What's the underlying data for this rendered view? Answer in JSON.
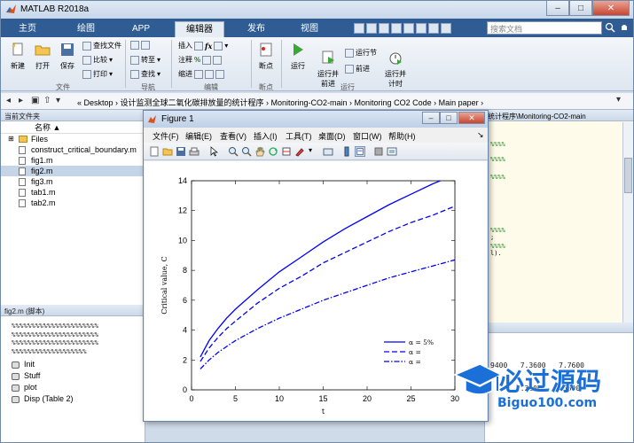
{
  "app": {
    "title": "MATLAB R2018a"
  },
  "tabs": [
    {
      "label": "主页"
    },
    {
      "label": "绘图"
    },
    {
      "label": "APP"
    },
    {
      "label": "编辑器"
    },
    {
      "label": "发布"
    },
    {
      "label": "视图"
    }
  ],
  "search": {
    "placeholder": "搜索文档"
  },
  "ribbon": {
    "file": {
      "new": "新建",
      "open": "打开",
      "save": "保存",
      "find_files": "查找文件",
      "compare": "比较",
      "print": "打印",
      "group": "文件"
    },
    "nav": {
      "goto": "转至",
      "find": "查找",
      "group": "导航"
    },
    "edit": {
      "insert": "插入",
      "comment": "注释",
      "indent": "缩进",
      "group": "编辑"
    },
    "breakpoints": {
      "label": "断点",
      "group": "断点"
    },
    "run": {
      "run": "运行",
      "run_advance": "运行并\n前进",
      "run_section": "运行节",
      "advance": "前进",
      "run_time": "运行并\n计时",
      "group": "运行"
    }
  },
  "pathbar": {
    "crumbs": "«  Desktop  ›  设计监测全球二氧化碳排放量的统计程序  ›  Monitoring-CO2-main  ›  Monitoring CO2 Code  ›  Main paper  ›"
  },
  "current_folder": {
    "header": "当前文件夹",
    "col_name": "名称 ▲",
    "items": [
      {
        "name": "Files"
      },
      {
        "name": "construct_critical_boundary.m"
      },
      {
        "name": "fig1.m"
      },
      {
        "name": "fig2.m"
      },
      {
        "name": "fig3.m"
      },
      {
        "name": "tab1.m"
      },
      {
        "name": "tab2.m"
      }
    ]
  },
  "details": {
    "header": "fig2.m  (脚本)",
    "pct_lines": [
      "%%%%%%%%%%%%%%%%%%%%%%",
      "%%%%%%%%%%%%%%%%%%%%%%",
      "%%%%%%%%%%%%%%%%%%%%%%",
      "%%%%%%%%%%%%%%%%%%%"
    ],
    "cells": [
      {
        "name": "Init"
      },
      {
        "name": "Stuff"
      },
      {
        "name": "plot"
      },
      {
        "name": "Disp (Table 2)"
      }
    ]
  },
  "editor": {
    "header": "统计程序\\Monitoring-CO2-main",
    "lines": [
      "%%%%",
      "%%%%",
      "%%%%",
      "%%%%",
      "%%%%",
      ";",
      "l)."
    ]
  },
  "command": {
    "row1": "9400   7.3600   7.7600",
    "row2": "      4.3200   4.5500"
  },
  "figure": {
    "title": "Figure 1",
    "menus": [
      "文件(F)",
      "编辑(E)",
      "查看(V)",
      "插入(I)",
      "工具(T)",
      "桌面(D)",
      "窗口(W)",
      "帮助(H)"
    ]
  },
  "chart_data": {
    "type": "line",
    "xlabel": "t",
    "ylabel": "Critical value, C",
    "xlim": [
      0,
      30
    ],
    "ylim": [
      0,
      14
    ],
    "xticks": [
      0,
      5,
      10,
      15,
      20,
      25,
      30
    ],
    "yticks": [
      0,
      2,
      4,
      6,
      8,
      10,
      12,
      14
    ],
    "x": [
      1,
      2,
      3,
      4,
      5,
      7.5,
      10,
      12.5,
      15,
      17.5,
      20,
      22.5,
      25,
      27.5,
      30
    ],
    "series": [
      {
        "name": "α = 5%",
        "style": "solid",
        "color": "#0000ff",
        "values": [
          2.2,
          3.3,
          4.1,
          4.8,
          5.4,
          6.7,
          7.9,
          8.9,
          9.9,
          10.8,
          11.6,
          12.4,
          13.1,
          13.8,
          14.4
        ]
      },
      {
        "name": "α = ",
        "style": "dashed",
        "color": "#0000ff",
        "values": [
          1.9,
          2.8,
          3.5,
          4.1,
          4.6,
          5.8,
          6.8,
          7.6,
          8.5,
          9.2,
          9.9,
          10.6,
          11.2,
          11.7,
          12.3
        ]
      },
      {
        "name": "α = ",
        "style": "dashdot",
        "color": "#0000ff",
        "values": [
          1.4,
          2.0,
          2.5,
          2.9,
          3.3,
          4.1,
          4.8,
          5.4,
          6.0,
          6.5,
          7.0,
          7.5,
          7.9,
          8.3,
          8.7
        ]
      }
    ],
    "legend": "bottom-right"
  },
  "watermark": {
    "cn": "必过源码",
    "en": "Biguo100.com"
  }
}
